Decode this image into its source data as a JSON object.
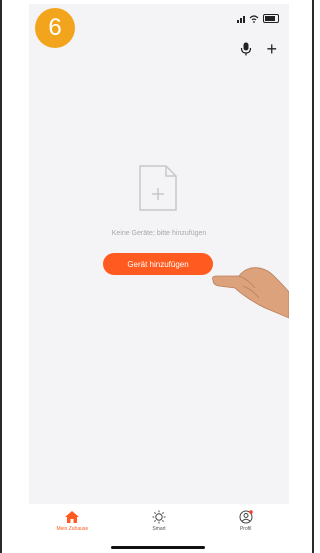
{
  "step_number": "6",
  "empty_state": {
    "message": "Keine Geräte; bitte hinzufügen",
    "button_label": "Gerät hinzufügen"
  },
  "top_bar": {
    "mic_icon": "microphone-icon",
    "add_icon": "plus-icon"
  },
  "tabs": [
    {
      "label": "Mein Zuhause",
      "icon": "home-icon",
      "active": true
    },
    {
      "label": "Smart",
      "icon": "sun-icon",
      "active": false
    },
    {
      "label": "Profil",
      "icon": "profile-icon",
      "active": false
    }
  ],
  "colors": {
    "accent": "#ff5a1f",
    "badge": "#f2a51c",
    "background": "#f4f4f6"
  }
}
